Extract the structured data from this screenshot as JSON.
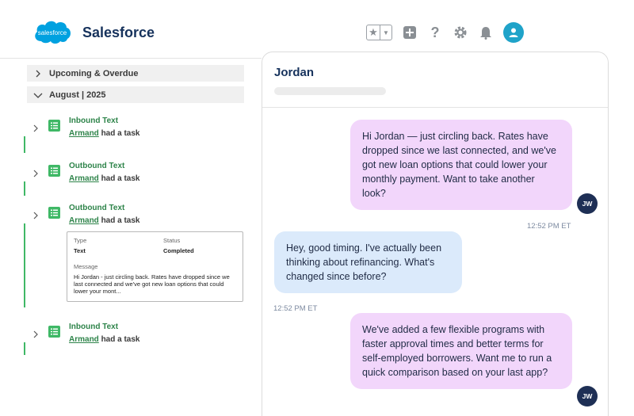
{
  "header": {
    "logo_text": "salesforce",
    "brand_name": "Salesforce",
    "icons": [
      "favorites-star-icon",
      "chevron-down-icon",
      "add-icon",
      "help-icon",
      "gear-icon",
      "bell-icon",
      "user-avatar-icon"
    ]
  },
  "sections": [
    {
      "label": "Upcoming & Overdue",
      "expanded": false
    },
    {
      "label": "August | 2025",
      "expanded": true
    }
  ],
  "activities": [
    {
      "title": "Inbound Text",
      "who": "Armand",
      "action": " had a task"
    },
    {
      "title": "Outbound Text",
      "who": "Armand",
      "action": " had a task"
    },
    {
      "title": "Outbound Text",
      "who": "Armand",
      "action": " had a task"
    },
    {
      "title": "Inbound Text",
      "who": "Armand",
      "action": " had a task"
    }
  ],
  "detail": {
    "type_label": "Type",
    "type_value": "Text",
    "status_label": "Status",
    "status_value": "Completed",
    "message_label": "Message",
    "message_value": "Hi Jordan - just circling back. Rates have dropped since we last connected and we've got new loan options that could lower your mont..."
  },
  "chat": {
    "contact_name": "Jordan",
    "messages": [
      {
        "direction": "outbound",
        "text": "Hi Jordan — just circling back. Rates have dropped since we last connected, and we've got new loan options that could lower your monthly payment. Want to take another look?",
        "initials": "JW",
        "time": "12:52 PM ET"
      },
      {
        "direction": "inbound",
        "text": "Hey, good timing. I've actually been thinking about refinancing. What's changed since before?",
        "time": "12:52 PM ET"
      },
      {
        "direction": "outbound",
        "text": "We've added a few flexible programs with faster approval times and better terms for self-employed borrowers. Want me to run a quick comparison based on your last app?",
        "initials": "JW"
      }
    ]
  },
  "colors": {
    "brand_blue": "#00a1e0",
    "activity_green": "#3fb866",
    "outbound_bubble": "#f2d6fb",
    "inbound_bubble": "#dbeafb",
    "avatar_navy": "#1e2f55"
  }
}
